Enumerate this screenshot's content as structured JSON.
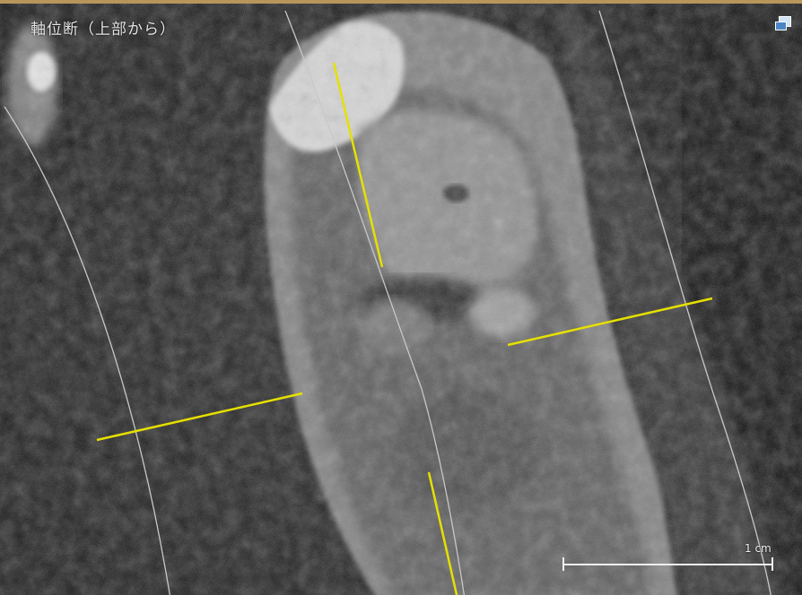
{
  "view": {
    "title": "軸位断（上部から）",
    "frame_accent_color": "#b8965a"
  },
  "overlay": {
    "guide_line_color": "#e6e000",
    "curve_color": "#c8c8c8"
  },
  "scale_bar": {
    "label": "1 cm"
  },
  "icons": {
    "window": "window-toggle-icon"
  }
}
